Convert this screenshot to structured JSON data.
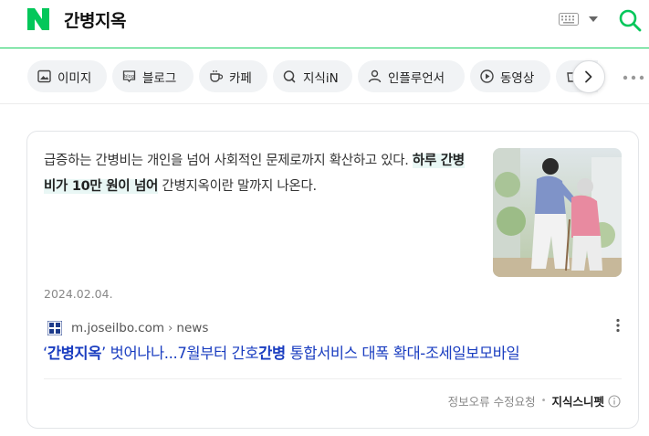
{
  "header": {
    "query": "간병지옥",
    "colors": {
      "brand": "#03C75A",
      "accent_line": "#19CE60"
    },
    "icons": [
      "naver-logo-icon",
      "keyboard-icon",
      "caret-down-icon",
      "search-icon"
    ]
  },
  "tabs": [
    {
      "label": "이미지",
      "icon": "image-icon"
    },
    {
      "label": "블로그",
      "icon": "blog-icon"
    },
    {
      "label": "카페",
      "icon": "cafe-icon"
    },
    {
      "label": "지식iN",
      "icon": "knowledge-icon"
    },
    {
      "label": "인플루언서",
      "icon": "person-icon"
    },
    {
      "label": "동영상",
      "icon": "play-icon"
    }
  ],
  "result": {
    "snippet_before": "급증하는 간병비는 개인을 넘어 사회적인 문제로까지 확산하고 있다. ",
    "snippet_highlight": "하루 간병비가 10만 원이 넘어",
    "snippet_after": " 간병지옥이란 말까지 나온다.",
    "date": "2024.02.04.",
    "source_domain": "m.joseilbo.com",
    "source_separator": "›",
    "source_section": "news",
    "title_open_quote": "‘",
    "title_bold_1": "간병지옥",
    "title_mid": "’ 벗어나나...7월부터 간호",
    "title_bold_2": "간병",
    "title_end": " 통합서비스 대폭 확대-조세일보모바일",
    "footer_report": "정보오류 수정요청",
    "footer_dot": "•",
    "footer_brand": "지식스니펫",
    "title_color": "#1A3DC0",
    "highlight_color": "#E9F7F5"
  }
}
